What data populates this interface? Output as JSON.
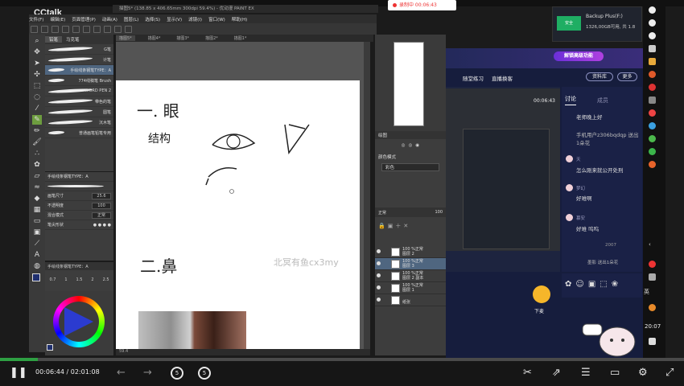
{
  "app": {
    "logo": "CCtalk",
    "window_title": "描图5* (138.85 x 406.65mm 300dpi 59.4%) - 优动漫 PAINT EX",
    "recording": "录制中 00:06:43"
  },
  "menu": [
    "文件(F)",
    "编辑(E)",
    "页面管理(P)",
    "动画(A)",
    "图层(L)",
    "选择(S)",
    "显示(V)",
    "滤镜(I)",
    "窗口(W)",
    "帮助(H)"
  ],
  "tabs": [
    "描图5*",
    "描图4*",
    "描图3*",
    "描图2*",
    "描图1*"
  ],
  "brush_panel": {
    "title": "笔刷",
    "tabs": [
      "铅笔",
      "马克笔"
    ],
    "items": [
      "G笔",
      "计笔",
      "手绘线条钢笔TYPE：A",
      "774线稿笔 Brush",
      "WORD PEN 2",
      "带色的笔",
      "圆笔",
      "沉木笔",
      "普通画笔铅笔专用"
    ]
  },
  "properties": {
    "brush_name": "手绘线条钢笔TYPE：A",
    "size_label": "画笔尺寸",
    "size_value": "25.6",
    "opacity_label": "不透明度",
    "opacity_value": "100",
    "blend_label": "混合模式",
    "blend_value": "正常",
    "tip_label": "笔尖形状",
    "sizes": [
      "0.7",
      "1",
      "1.5",
      "2",
      "2.5"
    ]
  },
  "canvas": {
    "watermark": "北冥有鱼cx3my",
    "sketch_1": "一. 眼",
    "sketch_2": "结构",
    "sketch_3": "二.鼻",
    "status": "59.4"
  },
  "right_panels": {
    "subtool_title": "绘图",
    "color_mode": "颜色模式",
    "color_value": "彩色",
    "blend": "正常",
    "opacity": "100",
    "layers": [
      {
        "pct": "100 %正常",
        "name": "图层 2"
      },
      {
        "pct": "100 %正常",
        "name": "图层 3"
      },
      {
        "pct": "100 %正常",
        "name": "图层 2 副本"
      },
      {
        "pct": "100 %正常",
        "name": "图层 1"
      },
      {
        "pct": "",
        "name": "纸张"
      }
    ]
  },
  "cctalk": {
    "badge": "解锁高级功能",
    "actions": [
      "随堂练习",
      "直播换客"
    ],
    "btn_library": "资料库",
    "btn_more": "更多",
    "video_time": "00:06:43",
    "hand_label": "下麦",
    "chat_tabs": [
      "讨论",
      "成员"
    ],
    "messages": [
      {
        "name": "",
        "text": "老师晚上好"
      },
      {
        "name": "",
        "text": "手机用户z306bqdqp 送出1朵花"
      },
      {
        "name": "天",
        "text": "怎么刚来就公开处刑"
      },
      {
        "name": "梦幻",
        "text": "好难啊"
      },
      {
        "name": "慕安",
        "text": "好难 呜呜"
      },
      {
        "name": "",
        "text": "2007"
      },
      {
        "name": "",
        "text": "墨影 送出1朵花"
      }
    ]
  },
  "backup": {
    "icon_text": "安全",
    "title": "Backup Plus(F:)",
    "subtitle": "1326,00GB可用, 共 1.8"
  },
  "system": {
    "clock": "20:07",
    "lang": "英"
  },
  "player": {
    "current": "00:06:44",
    "separator": "/",
    "total": "02:01:08",
    "progress": 0.055,
    "rewind_label": "5",
    "forward_label": "5"
  },
  "colors": {
    "accent_green": "#2ea043",
    "cct_bg": "#161d3d",
    "csp_bg": "#3d3d3d"
  }
}
